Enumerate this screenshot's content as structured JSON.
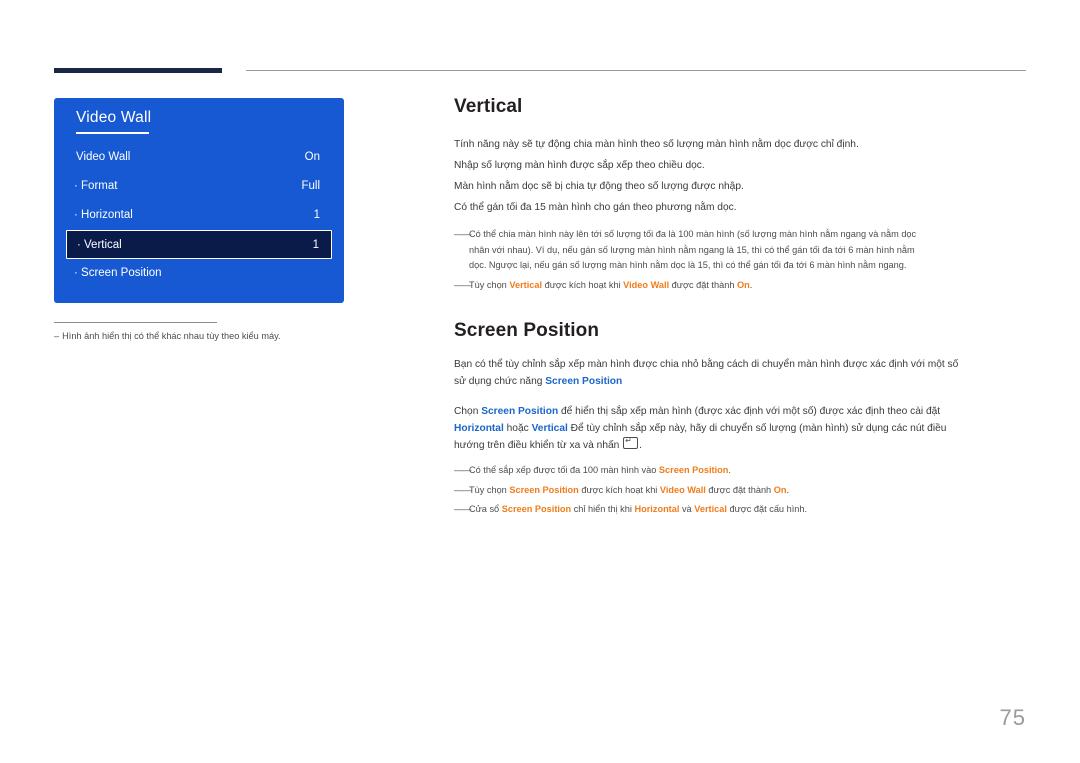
{
  "page_number": "75",
  "osd": {
    "title": "Video Wall",
    "rows": [
      {
        "label": "Video Wall",
        "value": "On",
        "indent": false,
        "selected": false
      },
      {
        "label": "· Format",
        "value": "Full",
        "indent": true,
        "selected": false
      },
      {
        "label": "· Horizontal",
        "value": "1",
        "indent": true,
        "selected": false
      },
      {
        "label": "· Vertical",
        "value": "1",
        "indent": true,
        "selected": true
      },
      {
        "label": "· Screen Position",
        "value": "",
        "indent": true,
        "selected": false
      }
    ],
    "note_dash": "–",
    "note": "Hình ảnh hiển thị có thể khác nhau tùy theo kiểu máy."
  },
  "sections": {
    "vertical": {
      "heading": "Vertical",
      "paragraphs": [
        "Tính năng này sẽ tự động chia màn hình theo số lượng màn hình nằm dọc được chỉ định.",
        "Nhập số lượng màn hình được sắp xếp theo chiều dọc.",
        "Màn hình nằm dọc sẽ bị chia tự động theo số lượng được nhập.",
        "Có thể gán tối đa 15 màn hình cho gán theo phương nằm dọc."
      ],
      "bullet1": {
        "dash": "――",
        "line1": "Có thể chia màn hình này lên tới số lượng tối đa là 100 màn hình (số lượng màn hình nằm ngang và nằm dọc",
        "line2": "nhân với nhau). Ví dụ, nếu gán số lượng màn hình nằm ngang là 15, thì có thể gán tối đa tới 6 màn hình nằm",
        "line3": "dọc. Ngược lại, nếu gán số lượng màn hình nằm dọc là 15, thì có thể gán tối đa tới 6 màn hình nằm ngang."
      },
      "bullet2": {
        "dash": "――",
        "t1": "Tùy chọn ",
        "k1": "Vertical",
        "t2": " được kích hoạt khi ",
        "k2": "Video Wall",
        "t3": " được đặt thành ",
        "k3": "On",
        "t4": "."
      }
    },
    "screen_position": {
      "heading": "Screen Position",
      "p1_line1": "Bạn có thể tùy chỉnh sắp xếp màn hình được chia nhỏ bằng cách di chuyển màn hình được xác định với một số",
      "p1_line2_a": "sử dụng chức năng ",
      "p1_line2_k": "Screen Position",
      "p2_line1_a": "Chọn ",
      "p2_line1_k": "Screen Position",
      "p2_line1_b": " để hiển thị sắp xếp màn hình (được xác định với một số) được xác định theo cài đặt",
      "p2_line2_k1": "Horizontal",
      "p2_line2_a": " hoặc ",
      "p2_line2_k2": "Vertical",
      "p2_line2_b": " Để tùy chỉnh sắp xếp này, hãy di chuyển số lượng (màn hình) sử dụng các nút điều",
      "p2_line3": "hướng trên điều khiển từ xa và nhấn ",
      "p2_line3_end": ".",
      "bullets": [
        {
          "dash": "――",
          "parts": [
            {
              "t": "Có thể sắp xếp được tối đa 100 màn hình vào ",
              "s": "plain"
            },
            {
              "t": "Screen Position",
              "s": "orange"
            },
            {
              "t": ".",
              "s": "plain"
            }
          ]
        },
        {
          "dash": "――",
          "parts": [
            {
              "t": "Tùy chọn ",
              "s": "plain"
            },
            {
              "t": "Screen Position",
              "s": "orange"
            },
            {
              "t": " được kích hoạt khi ",
              "s": "plain"
            },
            {
              "t": "Video Wall",
              "s": "orange"
            },
            {
              "t": " được đặt thành ",
              "s": "plain"
            },
            {
              "t": "On",
              "s": "orange"
            },
            {
              "t": ".",
              "s": "plain"
            }
          ]
        },
        {
          "dash": "――",
          "parts": [
            {
              "t": "Cửa sổ ",
              "s": "plain"
            },
            {
              "t": "Screen Position",
              "s": "orange"
            },
            {
              "t": " chỉ hiển thị khi ",
              "s": "plain"
            },
            {
              "t": "Horizontal",
              "s": "orange"
            },
            {
              "t": " và ",
              "s": "plain"
            },
            {
              "t": "Vertical",
              "s": "orange"
            },
            {
              "t": " được đặt cấu hình.",
              "s": "plain"
            }
          ]
        }
      ]
    }
  },
  "colors": {
    "osd_bg": "#1659d2",
    "osd_selected_bg": "#0a1b4a",
    "accent_orange": "#f07c1b",
    "accent_blue": "#1a66c9",
    "rule_dark": "#1a2744"
  }
}
